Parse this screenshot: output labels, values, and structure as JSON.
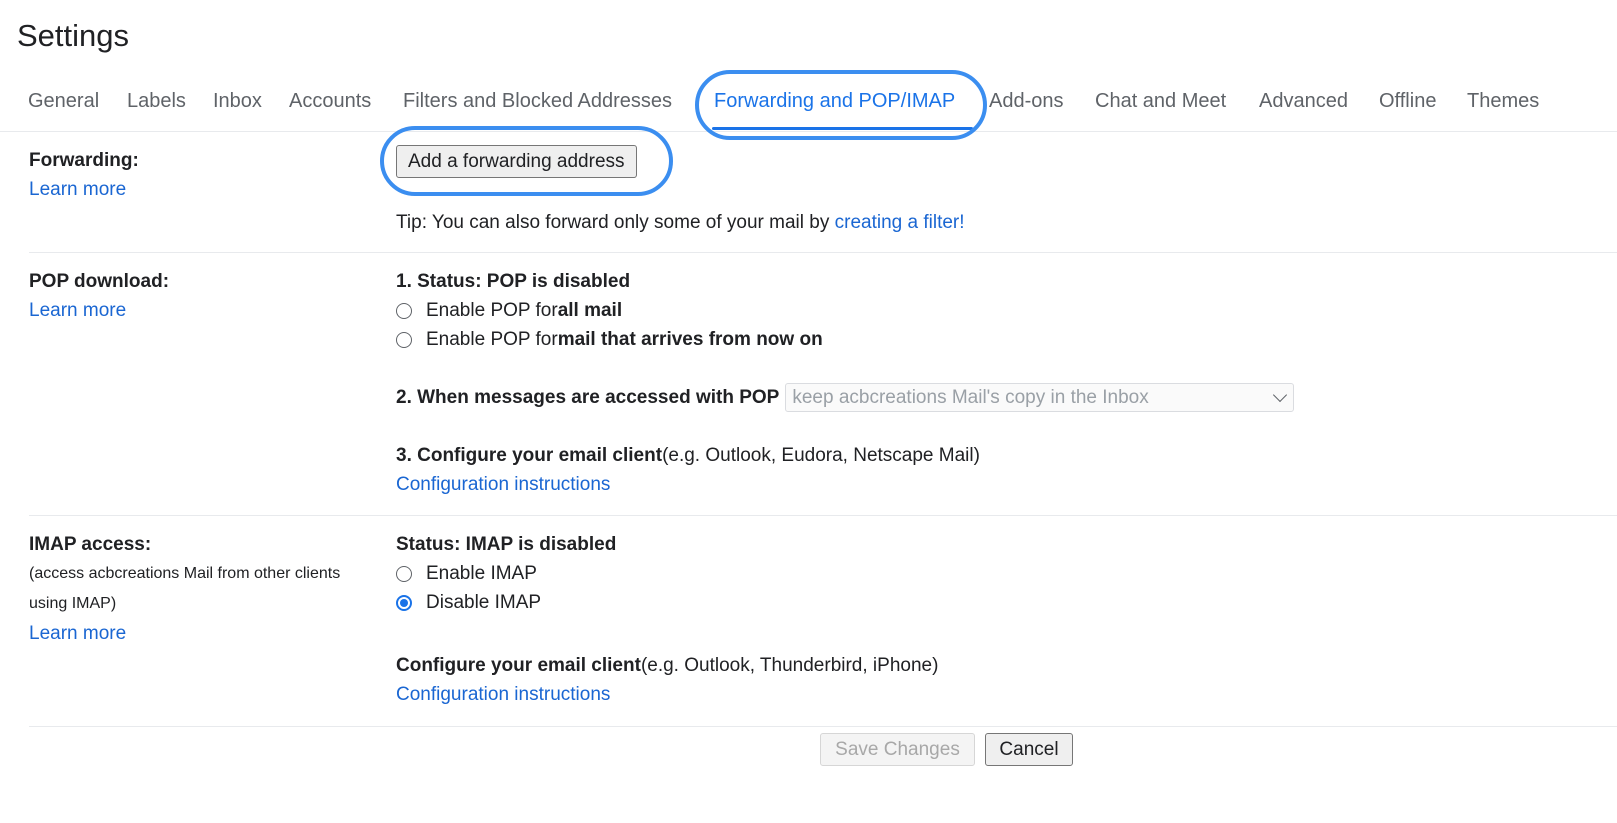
{
  "page": {
    "title": "Settings"
  },
  "tabs": [
    {
      "label": "General",
      "active": false
    },
    {
      "label": "Labels",
      "active": false
    },
    {
      "label": "Inbox",
      "active": false
    },
    {
      "label": "Accounts",
      "active": false
    },
    {
      "label": "Filters and Blocked Addresses",
      "active": false
    },
    {
      "label": "Forwarding and POP/IMAP",
      "active": true
    },
    {
      "label": "Add-ons",
      "active": false
    },
    {
      "label": "Chat and Meet",
      "active": false
    },
    {
      "label": "Advanced",
      "active": false
    },
    {
      "label": "Offline",
      "active": false
    },
    {
      "label": "Themes",
      "active": false
    }
  ],
  "forwarding": {
    "label": "Forwarding:",
    "learn_more": "Learn more",
    "add_button": "Add a forwarding address",
    "tip_prefix": "Tip: You can also forward only some of your mail by ",
    "tip_link": "creating a filter!"
  },
  "pop": {
    "label": "POP download:",
    "learn_more": "Learn more",
    "status": "1. Status: POP is disabled",
    "options": [
      {
        "prefix": "Enable POP for ",
        "bold": "all mail",
        "checked": false
      },
      {
        "prefix": "Enable POP for ",
        "bold": "mail that arrives from now on",
        "checked": false
      }
    ],
    "access_label": "2. When messages are accessed with POP",
    "access_select_value": "keep acbcreations Mail's copy in the Inbox",
    "configure_bold": "3. Configure your email client",
    "configure_rest": " (e.g. Outlook, Eudora, Netscape Mail)",
    "config_link": "Configuration instructions"
  },
  "imap": {
    "label": "IMAP access:",
    "sub_label_1": "(access acbcreations Mail from other clients",
    "sub_label_2": "using IMAP)",
    "learn_more": "Learn more",
    "status": "Status: IMAP is disabled",
    "options": [
      {
        "label": "Enable IMAP",
        "checked": false
      },
      {
        "label": "Disable IMAP",
        "checked": true
      }
    ],
    "configure_bold": "Configure your email client",
    "configure_rest": " (e.g. Outlook, Thunderbird, iPhone)",
    "config_link": "Configuration instructions"
  },
  "footer": {
    "save_label": "Save Changes",
    "cancel_label": "Cancel"
  },
  "colors": {
    "accent": "#1a73e8",
    "link": "#1a66d2",
    "highlight_ring": "#3b8ef0"
  }
}
